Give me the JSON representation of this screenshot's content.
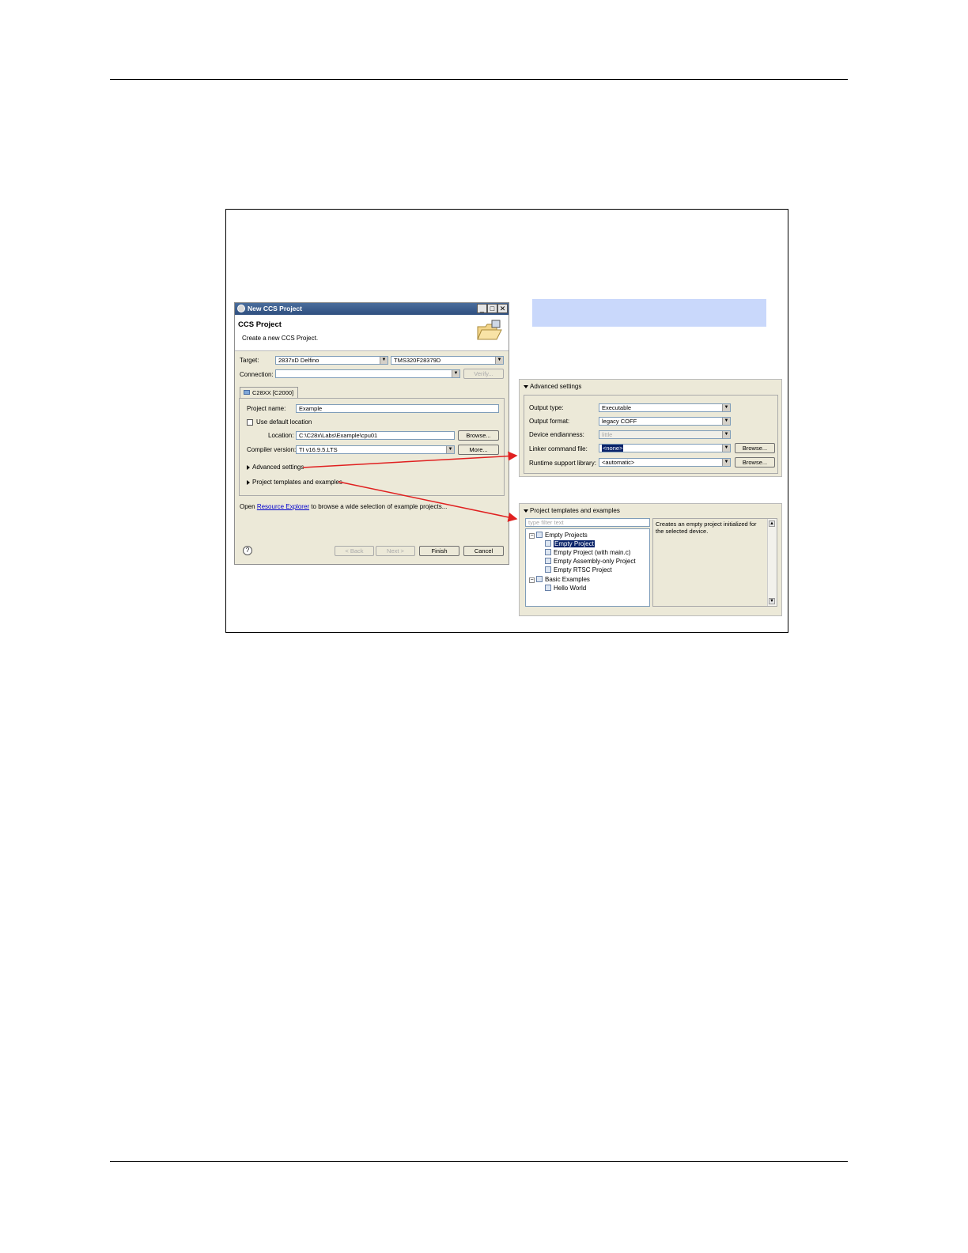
{
  "dialog": {
    "title": "New CCS Project",
    "header_title": "CCS Project",
    "header_subtitle": "Create a new CCS Project.",
    "target_label": "Target:",
    "target_family": "2837xD Delfino",
    "target_device": "TMS320F28379D",
    "connection_label": "Connection:",
    "connection_value": "",
    "verify_label": "Verify...",
    "tab_label": "C28XX [C2000]",
    "project_name_label": "Project name:",
    "project_name_value": "Example",
    "use_default_location_label": "Use default location",
    "location_label": "Location:",
    "location_value": "C:\\C28x\\Labs\\Example\\cpu01",
    "browse_label": "Browse...",
    "compiler_label": "Compiler version:",
    "compiler_value": "TI v16.9.5.LTS",
    "more_label": "More...",
    "advanced_settings_label": "Advanced settings",
    "templates_label": "Project templates and examples",
    "open_prefix": "Open",
    "resource_explorer_link": "Resource Explorer",
    "open_suffix": "to browse a wide selection of example projects...",
    "help_glyph": "?",
    "back_label": "< Back",
    "next_label": "Next >",
    "finish_label": "Finish",
    "cancel_label": "Cancel"
  },
  "advanced_panel": {
    "header": "Advanced settings",
    "output_type_label": "Output type:",
    "output_type_value": "Executable",
    "output_format_label": "Output format:",
    "output_format_value": "legacy COFF",
    "endianness_label": "Device endianness:",
    "endianness_value": "little",
    "linker_label": "Linker command file:",
    "linker_value": "<none>",
    "runtime_label": "Runtime support library:",
    "runtime_value": "<automatic>",
    "browse_label": "Browse..."
  },
  "templates_panel": {
    "header": "Project templates and examples",
    "filter_placeholder": "type filter text",
    "tree": {
      "empty_projects": "Empty Projects",
      "empty_project": "Empty Project",
      "empty_project_main": "Empty Project (with main.c)",
      "empty_assembly": "Empty Assembly-only Project",
      "empty_rtsc": "Empty RTSC Project",
      "basic_examples": "Basic Examples",
      "hello_world": "Hello World"
    },
    "description": "Creates an empty project initialized for the selected device."
  },
  "colors": {
    "callout_fill": "#c9d8fb",
    "arrow": "#e02020",
    "selection": "#0a246a"
  }
}
